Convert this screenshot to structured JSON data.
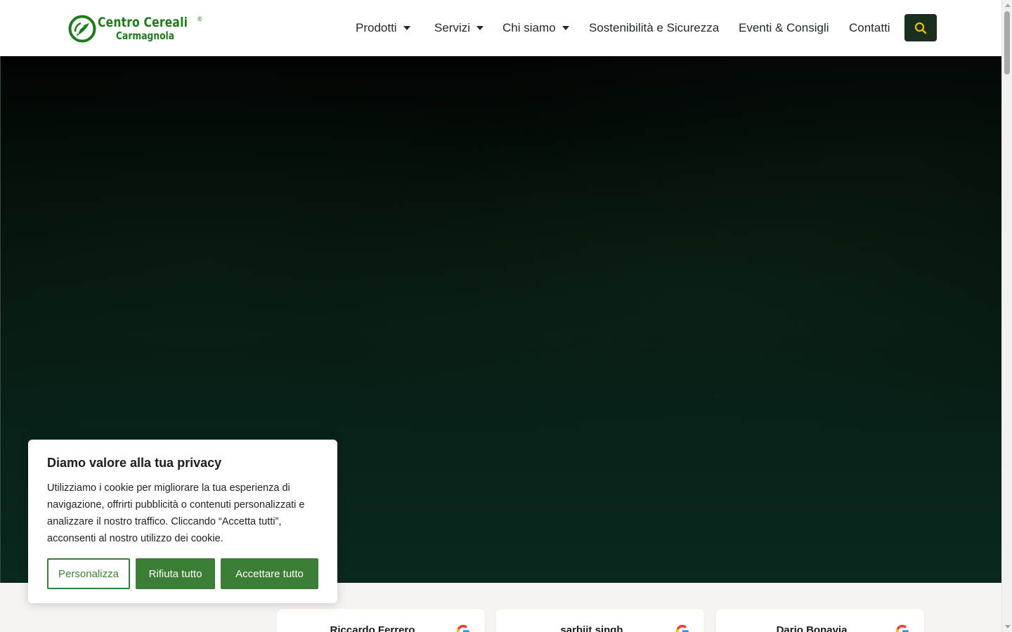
{
  "brand": {
    "name_line1": "Centro Cereali",
    "name_line2": "Carmagnola",
    "registered": "®",
    "color": "#1f7a1a"
  },
  "nav": {
    "items": [
      {
        "label": "Prodotti",
        "has_dropdown": true
      },
      {
        "label": "Servizi",
        "has_dropdown": true
      },
      {
        "label": "Chi siamo",
        "has_dropdown": true
      },
      {
        "label": "Sostenibilità e Sicurezza",
        "has_dropdown": false
      },
      {
        "label": "Eventi & Consigli",
        "has_dropdown": false
      },
      {
        "label": "Contatti",
        "has_dropdown": false
      }
    ],
    "search_icon": "search-icon",
    "search_button_color": "#1a2f1f",
    "search_icon_color": "#f2c200"
  },
  "hero": {
    "colors": [
      "#020403",
      "#0a281e"
    ]
  },
  "cookie_banner": {
    "title": "Diamo valore alla tua privacy",
    "text": "Utilizziamo i cookie per migliorare la tua esperienza di navigazione, offrirti pubblicità o contenuti personalizzati e analizzare il nostro traffico. Cliccando “Accetta tutti”, acconsenti al nostro utilizzo dei cookie.",
    "buttons": {
      "customize": "Personalizza",
      "reject": "Rifiuta tutto",
      "accept": "Accettare tutto"
    },
    "accent": "#3b7e35"
  },
  "reviews": [
    {
      "name": "Riccardo Ferrero",
      "source_icon": "google-icon"
    },
    {
      "name": "sarbjit singh",
      "source_icon": "google-icon"
    },
    {
      "name": "Dario Bonavia",
      "source_icon": "google-icon"
    }
  ]
}
